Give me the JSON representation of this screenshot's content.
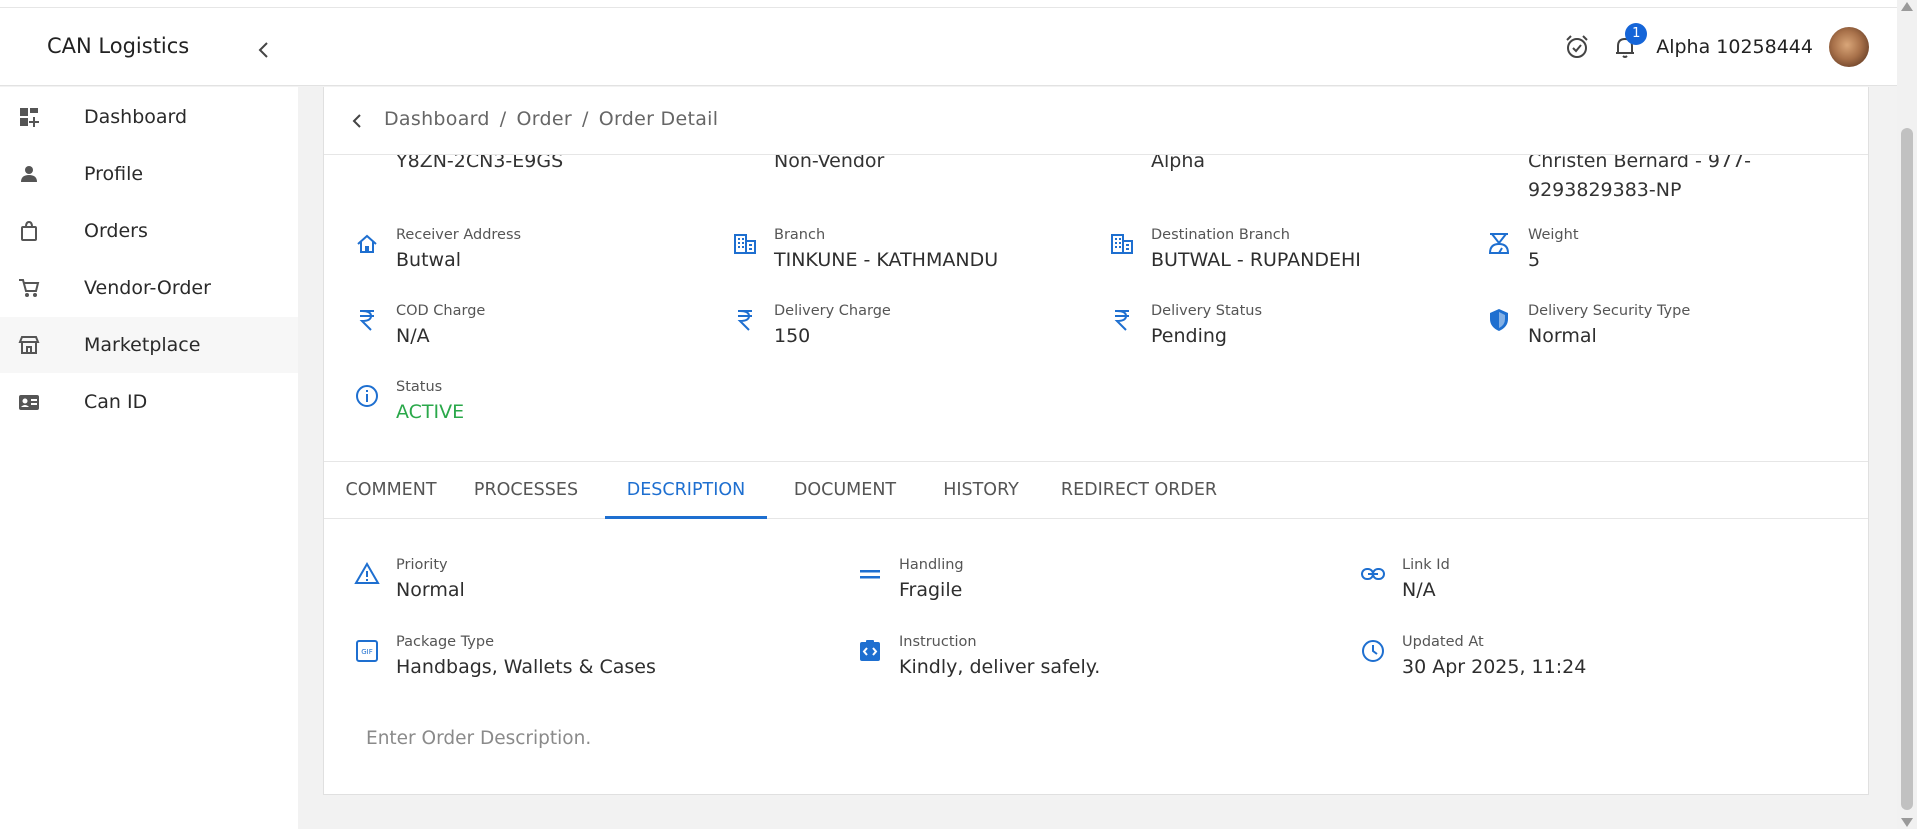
{
  "header": {
    "brand": "CAN Logistics",
    "notification_count": "1",
    "username": "Alpha 10258444"
  },
  "sidebar": {
    "items": [
      {
        "label": "Dashboard",
        "icon": "dashboard-icon"
      },
      {
        "label": "Profile",
        "icon": "person-icon"
      },
      {
        "label": "Orders",
        "icon": "shopping-bag-icon"
      },
      {
        "label": "Vendor-Order",
        "icon": "cart-icon"
      },
      {
        "label": "Marketplace",
        "icon": "storefront-icon"
      },
      {
        "label": "Can ID",
        "icon": "id-card-icon"
      }
    ]
  },
  "breadcrumb": {
    "items": [
      "Dashboard",
      "Order",
      "Order Detail"
    ],
    "separator": "/"
  },
  "order_info": {
    "cut_values": {
      "col1": "Y8ZN-2CN3-E9GS",
      "col2": "Non-Vendor",
      "col3": "Alpha",
      "col4_line1": "Christen Bernard - 977-",
      "col4_line2": "9293829383-NP"
    },
    "fields": [
      {
        "label": "Receiver Address",
        "value": "Butwal",
        "icon": "home-icon"
      },
      {
        "label": "Branch",
        "value": "TINKUNE - KATHMANDU",
        "icon": "building-icon"
      },
      {
        "label": "Destination Branch",
        "value": "BUTWAL - RUPANDEHI",
        "icon": "building-icon"
      },
      {
        "label": "Weight",
        "value": "5",
        "icon": "scale-icon"
      },
      {
        "label": "COD Charge",
        "value": "N/A",
        "icon": "rupee-icon"
      },
      {
        "label": "Delivery Charge",
        "value": "150",
        "icon": "rupee-icon"
      },
      {
        "label": "Delivery Status",
        "value": "Pending",
        "icon": "rupee-icon"
      },
      {
        "label": "Delivery Security Type",
        "value": "Normal",
        "icon": "shield-icon"
      },
      {
        "label": "Status",
        "value": "ACTIVE",
        "icon": "info-icon"
      }
    ]
  },
  "tabs": {
    "items": [
      "COMMENT",
      "PROCESSES",
      "DESCRIPTION",
      "DOCUMENT",
      "HISTORY",
      "REDIRECT ORDER"
    ],
    "active": "DESCRIPTION"
  },
  "description": {
    "fields": [
      {
        "label": "Priority",
        "value": "Normal",
        "icon": "warning-icon"
      },
      {
        "label": "Handling",
        "value": "Fragile",
        "icon": "equals-icon"
      },
      {
        "label": "Link Id",
        "value": "N/A",
        "icon": "link-icon"
      },
      {
        "label": "Package Type",
        "value": "Handbags, Wallets & Cases",
        "icon": "package-icon"
      },
      {
        "label": "Instruction",
        "value": "Kindly, deliver safely.",
        "icon": "code-clipboard-icon"
      },
      {
        "label": "Updated At",
        "value": "30 Apr 2025, 11:24",
        "icon": "clock-icon"
      }
    ],
    "placeholder": "Enter Order Description."
  },
  "colors": {
    "accent": "#1e6fd0",
    "status_active": "#2aa84a",
    "badge": "#1565d8"
  }
}
